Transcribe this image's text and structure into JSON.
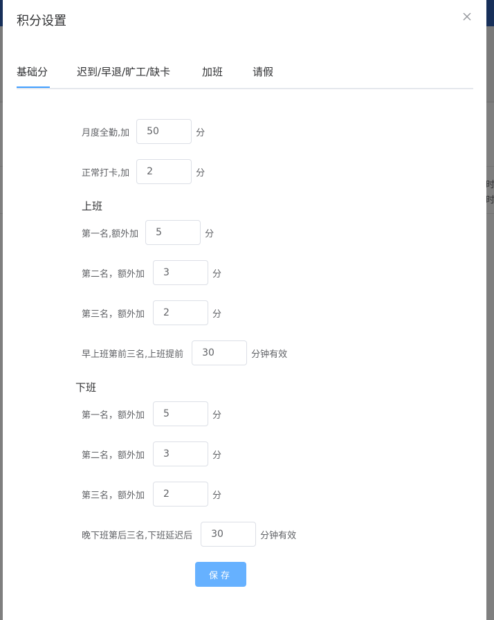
{
  "background": {
    "side_text_1": "时间",
    "side_text_2": "时间"
  },
  "dialog": {
    "title": "积分设置",
    "tabs": [
      {
        "label": "基础分"
      },
      {
        "label": "迟到/早退/旷工/缺卡"
      },
      {
        "label": "加班"
      },
      {
        "label": "请假"
      }
    ],
    "monthly_full_attendance": {
      "label": "月度全勤,加",
      "value": "50",
      "unit": "分"
    },
    "normal_clock_in": {
      "label": "正常打卡,加",
      "value": "2",
      "unit": "分"
    },
    "on_duty": {
      "heading": "上班",
      "first": {
        "label": "第一名,额外加",
        "value": "5",
        "unit": "分"
      },
      "second": {
        "label": "第二名，额外加",
        "value": "3",
        "unit": "分"
      },
      "third": {
        "label": "第三名，额外加",
        "value": "2",
        "unit": "分"
      },
      "early": {
        "label": "早上班第前三名,上班提前",
        "value": "30",
        "unit": "分钟有效"
      }
    },
    "off_duty": {
      "heading": "下班",
      "first": {
        "label": "第一名，额外加",
        "value": "5",
        "unit": "分"
      },
      "second": {
        "label": "第二名，额外加",
        "value": "3",
        "unit": "分"
      },
      "third": {
        "label": "第三名，额外加",
        "value": "2",
        "unit": "分"
      },
      "late": {
        "label": "晚下班第后三名,下班延迟后",
        "value": "30",
        "unit": "分钟有效"
      }
    },
    "save_label": "保存"
  },
  "colors": {
    "primary": "#409eff",
    "save_button": "#66b1ff",
    "topbar": "#2f5fb3"
  }
}
